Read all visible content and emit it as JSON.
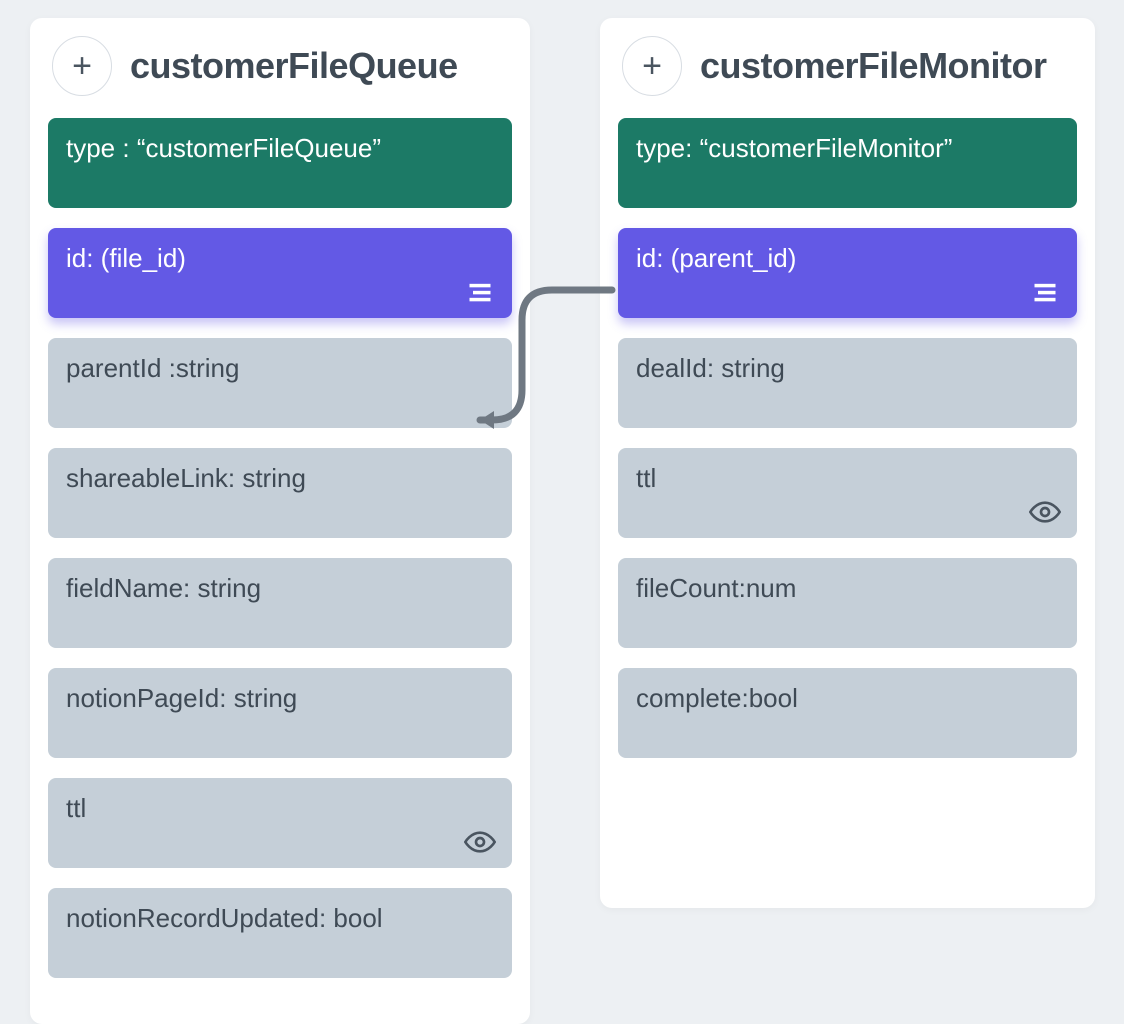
{
  "entities": {
    "left": {
      "title": "customerFileQueue",
      "type_label": "type : “customerFileQueue”",
      "id_label": "id: (file_id)",
      "fields": {
        "parentId": "parentId :string",
        "shareableLink": "shareableLink: string",
        "fieldName": "fieldName: string",
        "notionPageId": "notionPageId: string",
        "ttl": "ttl",
        "notionRecordUpdated": "notionRecordUpdated: bool"
      }
    },
    "right": {
      "title": "customerFileMonitor",
      "type_label": "type: “customerFileMonitor”",
      "id_label": "id: (parent_id)",
      "fields": {
        "dealId": "dealId: string",
        "ttl": "ttl",
        "fileCount": "fileCount:num",
        "complete": "complete:bool"
      }
    }
  },
  "colors": {
    "type_bg": "#1c7a66",
    "id_bg": "#6359e5",
    "field_bg": "#c5cfd8",
    "card_bg": "#ffffff",
    "page_bg": "#edf0f3",
    "text": "#3f4a55"
  },
  "relationship": {
    "from": "customerFileQueue.parentId",
    "to": "customerFileMonitor.id"
  }
}
